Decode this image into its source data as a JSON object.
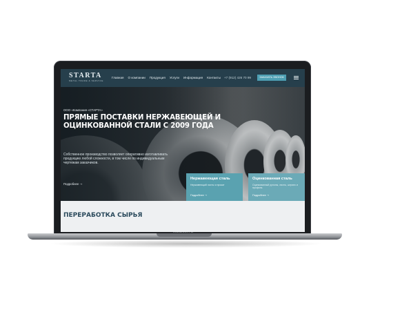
{
  "laptop": {
    "model": "MacBook Air"
  },
  "header": {
    "logo": "STARTA",
    "logo_sub": "METAL TRADE & SERVICE",
    "nav": [
      "Главная",
      "О компании",
      "Продукция",
      "Услуги",
      "Информация",
      "Контакты"
    ],
    "phone": "+7 (912) 426 70 99",
    "order_button": "ЗАКАЗАТЬ ЗВОНОК"
  },
  "hero": {
    "company": "ООО «Компания «СТАРТА»",
    "title": "ПРЯМЫЕ ПОСТАВКИ НЕРЖАВЕЮЩЕЙ И ОЦИНКОВАННОЙ СТАЛИ С 2009 ГОДА",
    "text": "Собственное производство позволяет оперативно изготавливать продукцию любой сложности, в том числе по индивидуальным чертежам заказчиков.",
    "more": "Подробнее ⇾"
  },
  "cards": [
    {
      "title": "Нержавеющая сталь",
      "desc": "Нержавеющий листы и прокат",
      "more": "Подробнее ⇾"
    },
    {
      "title": "Оцинкованная сталь",
      "desc": "Оцинкованный рулоны, листы, штрипс и профиль",
      "more": "Подробнее ⇾"
    }
  ],
  "section": {
    "title": "ПЕРЕРАБОТКА СЫРЬЯ"
  }
}
